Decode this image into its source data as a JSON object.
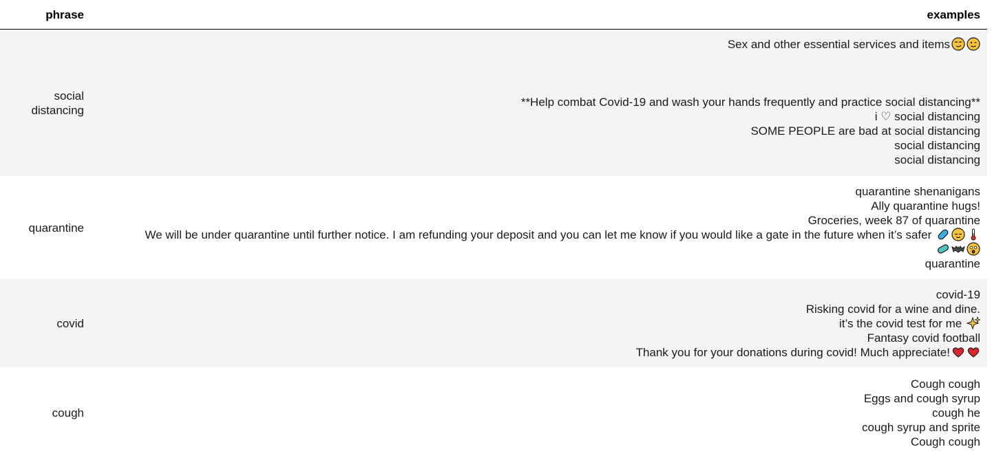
{
  "header": {
    "phrase": "phrase",
    "examples": "examples"
  },
  "rows": [
    {
      "phrase": "social distancing",
      "examples": [
        "Sex and other essential services and items",
        "**Help combat Covid-19 and wash your hands frequently and practice social distancing**",
        "i ♡ social distancing",
        "SOME PEOPLE are bad at social distancing",
        "social distancing",
        "social distancing"
      ],
      "emojis": [
        "smirking-face",
        "winking-face"
      ]
    },
    {
      "phrase": "quarantine",
      "examples": [
        "quarantine shenanigans",
        "Ally quarantine hugs!",
        "Groceries, week 87 of quarantine",
        "We will be under quarantine until further notice. I am refunding your deposit and you can let me know if you would like a gate in the future when it’s safer",
        "quarantine"
      ],
      "emojis": [
        "pill",
        "relieved-face",
        "thermometer",
        "pill",
        "bat",
        "astonished-face"
      ]
    },
    {
      "phrase": "covid",
      "examples": [
        "covid-19",
        "Risking covid for a wine and dine.",
        "it’s the covid test for me",
        "Fantasy covid football",
        "Thank you for your donations during covid! Much appreciate!"
      ],
      "emojis": [
        "sparkles",
        "red-heart",
        "red-heart"
      ]
    },
    {
      "phrase": "cough",
      "examples": [
        "Cough cough",
        "Eggs and cough syrup",
        "cough he",
        "cough syrup and sprite",
        "Cough cough"
      ]
    }
  ]
}
